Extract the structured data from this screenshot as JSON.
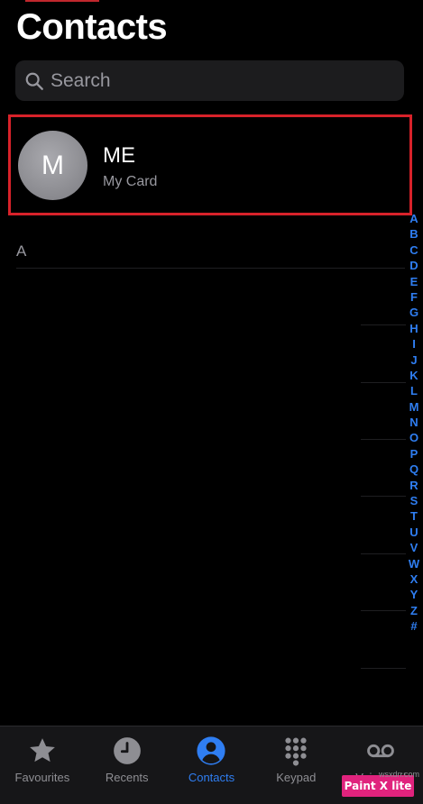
{
  "header": {
    "title": "Contacts"
  },
  "search": {
    "placeholder": "Search",
    "icon": "magnifier-icon"
  },
  "my_card": {
    "initial": "M",
    "name": "ME",
    "subtitle": "My Card",
    "highlight_color": "#d8222a"
  },
  "sections": [
    {
      "letter": "A"
    }
  ],
  "index": [
    "A",
    "B",
    "C",
    "D",
    "E",
    "F",
    "G",
    "H",
    "I",
    "J",
    "K",
    "L",
    "M",
    "N",
    "O",
    "P",
    "Q",
    "R",
    "S",
    "T",
    "U",
    "V",
    "W",
    "X",
    "Y",
    "Z",
    "#"
  ],
  "tab_bar": {
    "active": "contacts",
    "tabs": [
      {
        "id": "favourites",
        "label": "Favourites",
        "icon": "star-icon"
      },
      {
        "id": "recents",
        "label": "Recents",
        "icon": "clock-icon"
      },
      {
        "id": "contacts",
        "label": "Contacts",
        "icon": "person-circle-icon"
      },
      {
        "id": "keypad",
        "label": "Keypad",
        "icon": "keypad-icon"
      },
      {
        "id": "voicemail",
        "label": "Voicemail",
        "icon": "voicemail-icon"
      }
    ]
  },
  "watermark": {
    "label": "Paint X lite",
    "site": "wsxdn.com"
  },
  "colors": {
    "accent": "#2f7ef2",
    "background": "#000000",
    "secondary_text": "#98989f"
  }
}
